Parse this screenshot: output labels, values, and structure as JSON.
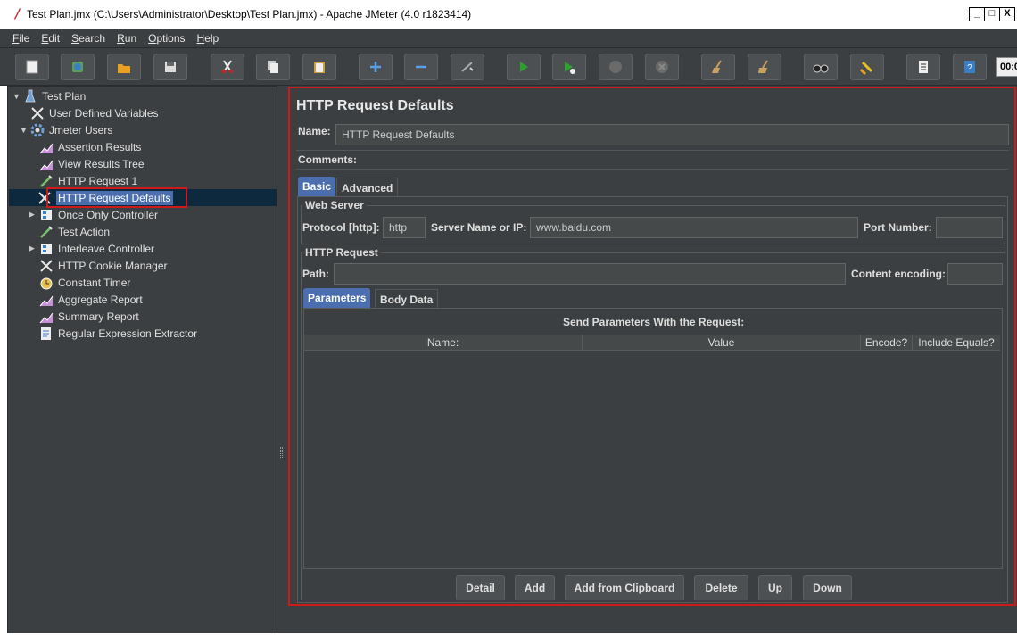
{
  "window": {
    "title": "Test Plan.jmx (C:\\Users\\Administrator\\Desktop\\Test Plan.jmx) - Apache JMeter (4.0 r1823414)",
    "min": "_",
    "max": "□",
    "close": "X"
  },
  "menu": [
    {
      "ul": "F",
      "rest": "ile"
    },
    {
      "ul": "E",
      "rest": "dit"
    },
    {
      "ul": "S",
      "rest": "earch"
    },
    {
      "ul": "R",
      "rest": "un"
    },
    {
      "ul": "O",
      "rest": "ptions"
    },
    {
      "ul": "H",
      "rest": "elp"
    }
  ],
  "toolbar": {
    "timer": "00:0"
  },
  "tree": {
    "items": [
      "Test Plan",
      "User Defined Variables",
      "Jmeter Users",
      "Assertion Results",
      "View Results Tree",
      "HTTP Request 1",
      "HTTP Request Defaults",
      "Once Only Controller",
      "Test Action",
      "Interleave Controller",
      "HTTP Cookie Manager",
      "Constant Timer",
      "Aggregate Report",
      "Summary Report",
      "Regular Expression Extractor"
    ]
  },
  "panel": {
    "title": "HTTP Request Defaults",
    "name_label": "Name:",
    "name_value": "HTTP Request Defaults",
    "comments_label": "Comments:",
    "tabs": [
      "Basic",
      "Advanced"
    ],
    "web_server": {
      "title": "Web Server",
      "protocol_label": "Protocol [http]:",
      "protocol_value": "http",
      "server_label": "Server Name or IP:",
      "server_value": "www.baidu.com",
      "port_label": "Port Number:",
      "port_value": ""
    },
    "http_request": {
      "title": "HTTP Request",
      "path_label": "Path:",
      "path_value": "",
      "encoding_label": "Content encoding:",
      "encoding_value": ""
    },
    "param_tabs": [
      "Parameters",
      "Body Data"
    ],
    "params_heading": "Send Parameters With the Request:",
    "columns": [
      "Name:",
      "Value",
      "Encode?",
      "Include Equals?"
    ],
    "buttons": [
      "Detail",
      "Add",
      "Add from Clipboard",
      "Delete",
      "Up",
      "Down"
    ]
  }
}
